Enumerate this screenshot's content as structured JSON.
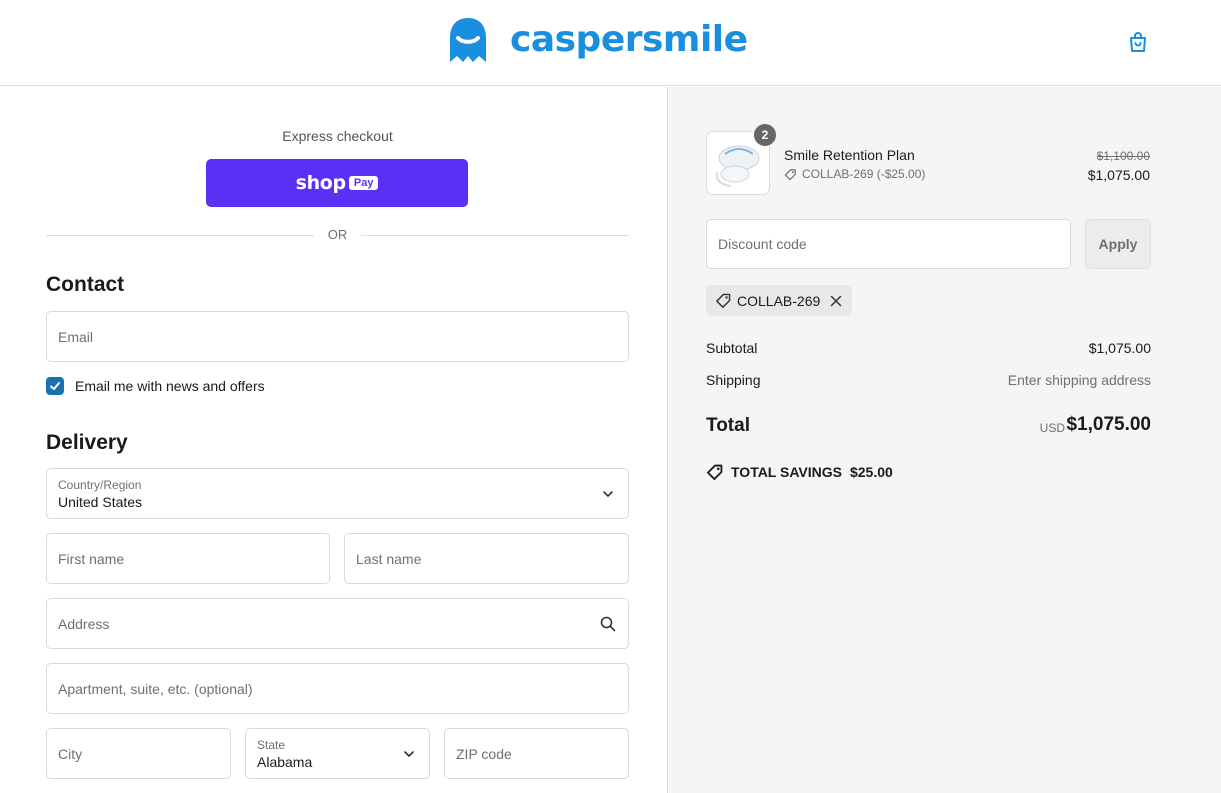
{
  "brand": {
    "name": "caspersmile",
    "color": "#1a8fdf"
  },
  "header": {
    "cart_icon": "shopping-bag-icon"
  },
  "express": {
    "label": "Express checkout",
    "shop_pay": {
      "shop_text": "shop",
      "pay_text": "Pay",
      "color": "#5a31f4"
    },
    "divider_text": "OR"
  },
  "contact": {
    "heading": "Contact",
    "email_placeholder": "Email",
    "newsletter_label": "Email me with news and offers",
    "newsletter_checked": true
  },
  "delivery": {
    "heading": "Delivery",
    "country_label": "Country/Region",
    "country_value": "United States",
    "first_name_placeholder": "First name",
    "last_name_placeholder": "Last name",
    "address_placeholder": "Address",
    "apartment_placeholder": "Apartment, suite, etc. (optional)",
    "city_placeholder": "City",
    "state_label": "State",
    "state_value": "Alabama",
    "zip_placeholder": "ZIP code"
  },
  "summary": {
    "item": {
      "name": "Smile Retention Plan",
      "quantity": "2",
      "discount": "COLLAB-269 (-$25.00)",
      "original_price": "$1,100.00",
      "price": "$1,075.00"
    },
    "discount_placeholder": "Discount code",
    "apply_label": "Apply",
    "applied_code": "COLLAB-269",
    "subtotal_label": "Subtotal",
    "subtotal_value": "$1,075.00",
    "shipping_label": "Shipping",
    "shipping_value": "Enter shipping address",
    "total_label": "Total",
    "currency": "USD",
    "total_value": "$1,075.00",
    "savings_label": "TOTAL SAVINGS",
    "savings_value": "$25.00"
  }
}
